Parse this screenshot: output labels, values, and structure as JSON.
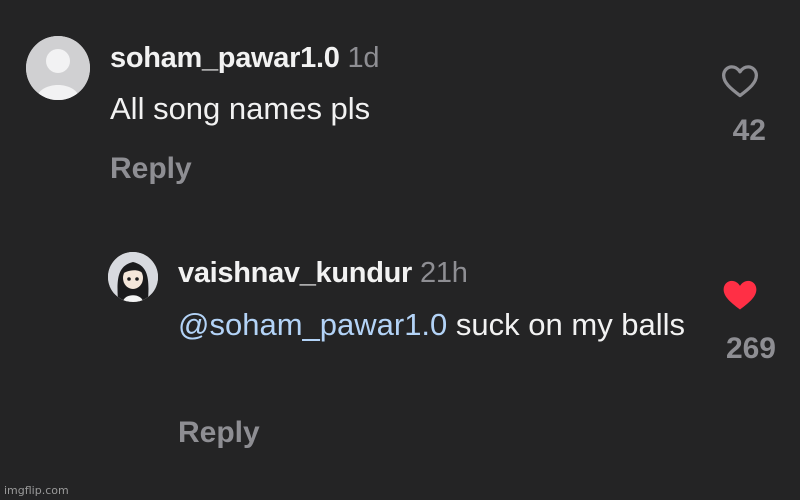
{
  "comments": [
    {
      "username": "soham_pawar1.0",
      "timestamp": "1d",
      "text": "All song names pls",
      "reply_label": "Reply",
      "likes": "42",
      "liked": false,
      "avatar_icon": "default-avatar-icon"
    },
    {
      "username": "vaishnav_kundur",
      "timestamp": "21h",
      "mention": "@soham_pawar1.0",
      "text": "suck on my balls",
      "reply_label": "Reply",
      "likes": "269",
      "liked": true,
      "avatar_icon": "anime-avatar-icon"
    }
  ],
  "colors": {
    "background": "#242425",
    "text": "#f2f2f2",
    "muted": "#8e8e93",
    "mention": "#b3d3f7",
    "like_red": "#ff2f45"
  },
  "watermark": "imgflip.com"
}
